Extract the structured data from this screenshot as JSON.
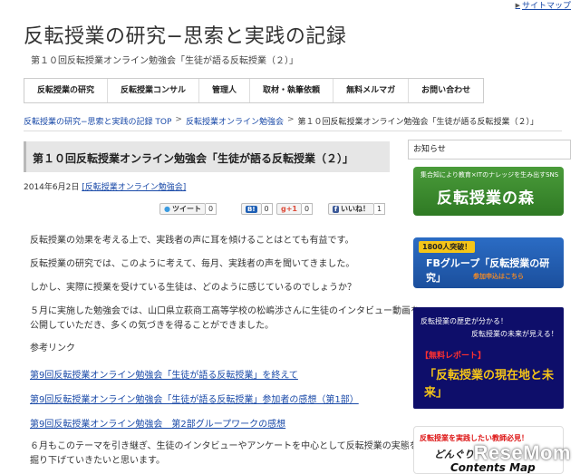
{
  "topbar": {
    "sitemap": "サイトマップ"
  },
  "site": {
    "title": "反転授業の研究−思索と実践の記録",
    "subtitle": "第１０回反転授業オンライン勉強会「生徒が語る反転授業（２）」"
  },
  "nav": [
    "反転授業の研究",
    "反転授業コンサル",
    "管理人",
    "取材・執筆依頼",
    "無料メルマガ",
    "お問い合わせ"
  ],
  "breadcrumb": {
    "home": "反転授業の研究−思索と実践の記録 TOP",
    "sep": ">",
    "category": "反転授業オンライン勉強会",
    "current": "第１０回反転授業オンライン勉強会「生徒が語る反転授業（２）」"
  },
  "post": {
    "title": "第１０回反転授業オンライン勉強会「生徒が語る反転授業（２）」",
    "date": "2014年6月2日",
    "category": "[反転授業オンライン勉強会]",
    "share": {
      "tweet": "ツイート",
      "tweet_count": "0",
      "hatena_icon": "B!",
      "hatena_count": "0",
      "gplus": "g+1",
      "gplus_count": "0",
      "like": "いいね！",
      "like_count": "1"
    },
    "paragraphs": [
      "反転授業の効果を考える上で、実践者の声に耳を傾けることはとても有益です。",
      "反転授業の研究では、このように考えて、毎月、実践者の声を聞いてきました。",
      "しかし、実際に授業を受けている生徒は、どのように感じているのでしょうか？",
      "５月に実施した勉強会では、山口県立萩商工高等学校の松嶋渉さんに生徒のインタビュー動画を",
      "公開していただき、多くの気づきを得ることができました。",
      "参考リンク"
    ],
    "links": [
      "第9回反転授業オンライン勉強会「生徒が語る反転授業」を終えて",
      "第9回反転授業オンライン勉強会「生徒が語る反転授業」参加者の感想（第1部）",
      "第9回反転授業オンライン勉強会　第2部グループワークの感想"
    ],
    "closing": [
      "６月もこのテーマを引き継ぎ、生徒のインタビューやアンケートを中心として反転授業の実態を",
      "掘り下げていきたいと思います。"
    ]
  },
  "sidebar": {
    "heading": "お知らせ",
    "banner1": {
      "small": "集合知により教育×ITのナレッジを生み出すSNS",
      "big": "反転授業の森"
    },
    "banner2": {
      "tag": "1800人突破！",
      "big": "FBグループ「反転授業の研究」",
      "sub": "参加申込はこちら"
    },
    "banner3": {
      "l1": "反転授業の歴史が分かる！",
      "l2": "反転授業の未来が見える！",
      "red": "【無料レポート】",
      "big": "「反転授業の現在地と未来」"
    },
    "banner4": {
      "l1": "反転授業を実践したい教師必見！",
      "l2": "どんぐり",
      "l3": "Contents Map"
    }
  },
  "watermark": "ReseMom"
}
